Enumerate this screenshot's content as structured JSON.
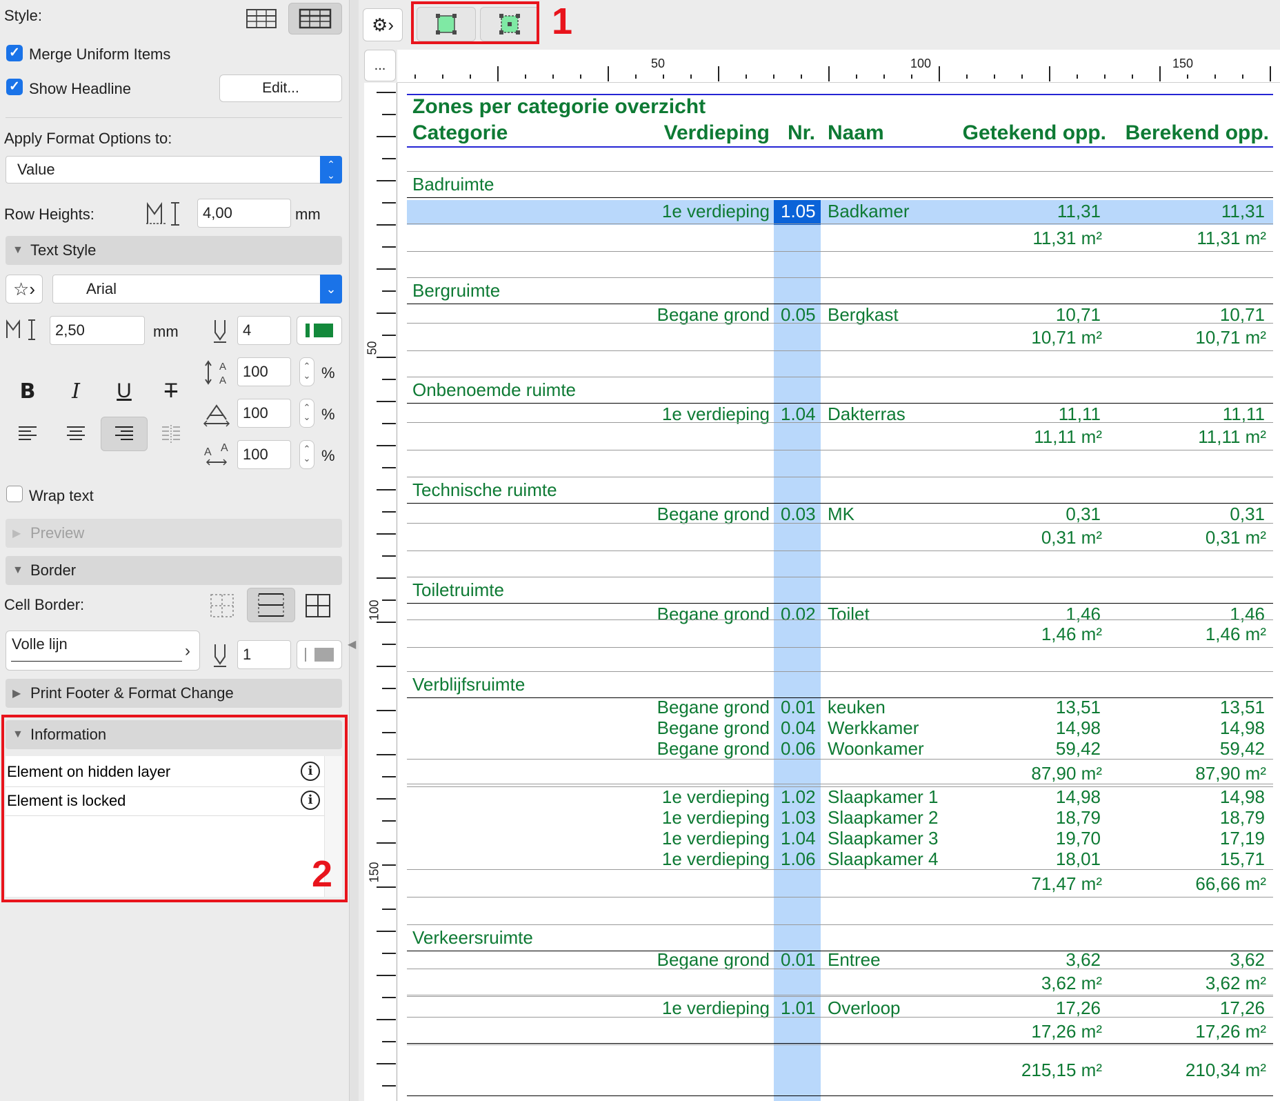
{
  "left_panel": {
    "style_label": "Style:",
    "merge_uniform": "Merge Uniform Items",
    "show_headline": "Show Headline",
    "edit_button": "Edit...",
    "apply_format_label": "Apply Format Options to:",
    "apply_format_value": "Value",
    "row_heights_label": "Row Heights:",
    "row_heights_value": "4,00",
    "row_heights_unit": "mm",
    "text_style_header": "Text Style",
    "font_name": "Arial",
    "font_size": "2,50",
    "font_size_unit": "mm",
    "pen_number": "4",
    "line_spacing": "100",
    "width_factor": "100",
    "char_spacing": "100",
    "percent": "%",
    "wrap_text": "Wrap text",
    "preview_header": "Preview",
    "border_header": "Border",
    "cell_border_label": "Cell Border:",
    "line_type": "Volle lijn",
    "border_pen": "1",
    "print_footer_header": "Print Footer & Format Change",
    "information_header": "Information",
    "info_items": [
      "Element on hidden layer",
      "Element is locked"
    ],
    "annotation_2": "2"
  },
  "toolbar": {
    "more_button": "...",
    "annotation_1": "1"
  },
  "ruler": {
    "top_labels": [
      "50",
      "100",
      "150"
    ],
    "left_labels": [
      "50",
      "100",
      "150"
    ]
  },
  "colors": {
    "text_green": "#0e7a34",
    "selection_blue": "#b9d8fb",
    "selected_cell": "#0b63d8",
    "annotation_red": "#e8141c"
  },
  "schedule": {
    "title": "Zones per categorie overzicht",
    "columns": [
      "Categorie",
      "Verdieping",
      "Nr.",
      "Naam",
      "Getekend opp.",
      "Berekend opp."
    ],
    "groups": [
      {
        "name": "Badruimte"
      },
      {
        "name": "Bergruimte"
      },
      {
        "name": "Onbenoemde ruimte"
      },
      {
        "name": "Technische ruimte"
      },
      {
        "name": "Toiletruimte"
      },
      {
        "name": "Verblijfsruimte"
      },
      {
        "name": "Verkeersruimte"
      }
    ],
    "rows": [
      {
        "floor": "1e verdieping",
        "nr": "1.05",
        "name": "Badkamer",
        "drawn": "11,31",
        "calc": "11,31"
      },
      {
        "floor": "Begane grond",
        "nr": "0.05",
        "name": "Bergkast",
        "drawn": "10,71",
        "calc": "10,71"
      },
      {
        "floor": "1e verdieping",
        "nr": "1.04",
        "name": "Dakterras",
        "drawn": "11,11",
        "calc": "11,11"
      },
      {
        "floor": "Begane grond",
        "nr": "0.03",
        "name": "MK",
        "drawn": "0,31",
        "calc": "0,31"
      },
      {
        "floor": "Begane grond",
        "nr": "0.02",
        "name": "Toilet",
        "drawn": "1,46",
        "calc": "1,46"
      },
      {
        "floor": "Begane grond",
        "nr": "0.01",
        "name": "keuken",
        "drawn": "13,51",
        "calc": "13,51"
      },
      {
        "floor": "Begane grond",
        "nr": "0.04",
        "name": "Werkkamer",
        "drawn": "14,98",
        "calc": "14,98"
      },
      {
        "floor": "Begane grond",
        "nr": "0.06",
        "name": "Woonkamer",
        "drawn": "59,42",
        "calc": "59,42"
      },
      {
        "floor": "1e verdieping",
        "nr": "1.02",
        "name": "Slaapkamer 1",
        "drawn": "14,98",
        "calc": "14,98"
      },
      {
        "floor": "1e verdieping",
        "nr": "1.03",
        "name": "Slaapkamer 2",
        "drawn": "18,79",
        "calc": "18,79"
      },
      {
        "floor": "1e verdieping",
        "nr": "1.04",
        "name": "Slaapkamer 3",
        "drawn": "19,70",
        "calc": "17,19"
      },
      {
        "floor": "1e verdieping",
        "nr": "1.06",
        "name": "Slaapkamer 4",
        "drawn": "18,01",
        "calc": "15,71"
      },
      {
        "floor": "Begane grond",
        "nr": "0.01",
        "name": "Entree",
        "drawn": "3,62",
        "calc": "3,62"
      },
      {
        "floor": "1e verdieping",
        "nr": "1.01",
        "name": "Overloop",
        "drawn": "17,26",
        "calc": "17,26"
      }
    ],
    "subtotals": [
      {
        "drawn": "11,31 m²",
        "calc": "11,31 m²"
      },
      {
        "drawn": "10,71 m²",
        "calc": "10,71 m²"
      },
      {
        "drawn": "11,11 m²",
        "calc": "11,11 m²"
      },
      {
        "drawn": "0,31 m²",
        "calc": "0,31 m²"
      },
      {
        "drawn": "1,46 m²",
        "calc": "1,46 m²"
      },
      {
        "drawn": "87,90 m²",
        "calc": "87,90 m²"
      },
      {
        "drawn": "71,47 m²",
        "calc": "66,66 m²"
      },
      {
        "drawn": "3,62 m²",
        "calc": "3,62 m²"
      },
      {
        "drawn": "17,26 m²",
        "calc": "17,26 m²"
      }
    ],
    "grand_total": {
      "drawn": "215,15 m²",
      "calc": "210,34 m²"
    }
  }
}
